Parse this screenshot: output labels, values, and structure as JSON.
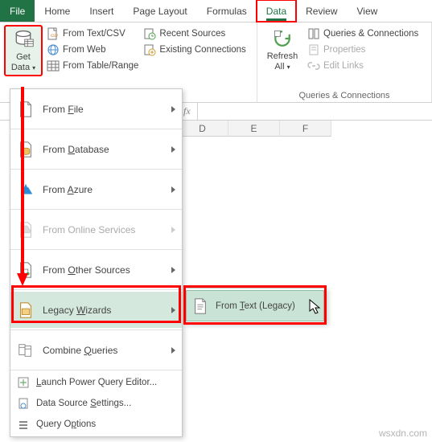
{
  "tabs": {
    "file": "File",
    "home": "Home",
    "insert": "Insert",
    "page_layout": "Page Layout",
    "formulas": "Formulas",
    "data": "Data",
    "review": "Review",
    "view": "View"
  },
  "ribbon": {
    "get_data": {
      "label1": "Get",
      "label2": "Data"
    },
    "from_text_csv": "From Text/CSV",
    "from_web": "From Web",
    "from_table_range": "From Table/Range",
    "recent_sources": "Recent Sources",
    "existing_connections": "Existing Connections",
    "refresh_all": {
      "label1": "Refresh",
      "label2": "All"
    },
    "queries_connections": "Queries & Connections",
    "properties": "Properties",
    "edit_links": "Edit Links",
    "group_qc": "Queries & Connections"
  },
  "formula_bar": {
    "fx": "fx"
  },
  "columns": [
    "D",
    "E",
    "F"
  ],
  "menu": {
    "from_file": "From File",
    "from_database": "From Database",
    "from_azure": "From Azure",
    "from_online_services": "From Online Services",
    "from_other_sources": "From Other Sources",
    "legacy_wizards": "Legacy Wizards",
    "combine_queries": "Combine Queries",
    "launch_pqe": "Launch Power Query Editor...",
    "data_source_settings": "Data Source Settings...",
    "query_options": "Query Options"
  },
  "submenu": {
    "from_text_legacy": "From Text (Legacy)"
  },
  "watermark": "wsxdn.com"
}
